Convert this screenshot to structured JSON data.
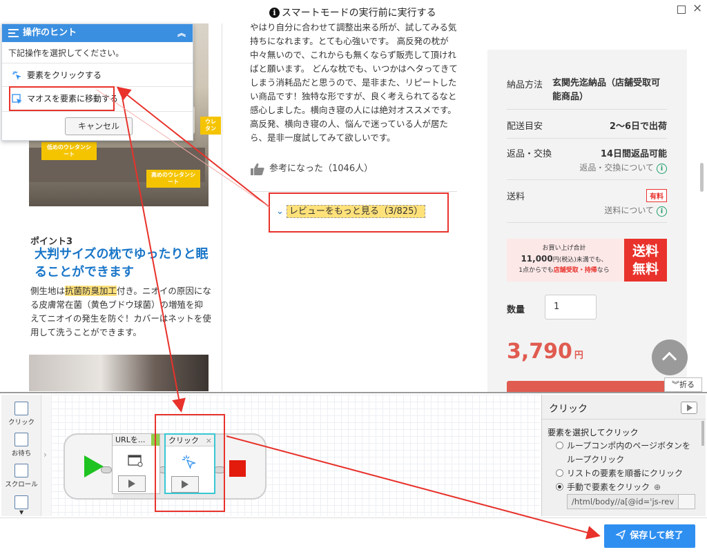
{
  "topbar": {
    "title": "スマートモードの実行前に実行する",
    "info_icon": "i"
  },
  "left_column": {
    "product_tags": [
      "低めのウレタンシート",
      "高めのウレタンシート",
      "ウレタン"
    ],
    "point_label": "ポイント3",
    "point_title": "大判サイズの枕でゆったりと眠ることができます",
    "point_body_pre": "側生地は",
    "point_body_highlight": "抗菌防臭加工",
    "point_body_post": "付き。ニオイの原因になる皮膚常在菌（黄色ブドウ球菌）の増殖を抑えてニオイの発生を防ぐ！カバーはネットを使用して洗うことができます。"
  },
  "review": {
    "text": "やはり自分に合わせて調整出来る所が、試してみる気持ちになれます。とても心強いです。 高反発の枕が中々無いので、これからも無くならず販売して頂ければと願います。 どんな枕でも、いつかはヘタってきてしまう消耗品だと思うので、是非また、リピートしたい商品です！独特な形ですが、良く考えられてるなと感心しました。横向き寝の人には絶対オススメです。高反発、横向き寝の人、悩んで迷っている人が居たら、是非一度試してみて欲しいです。",
    "helpful": "参考になった（1046人）",
    "more_reviews": "レビューをもっと見る（3/825）"
  },
  "info_panel": {
    "delivery_method_label": "納品方法",
    "delivery_method_value": "玄関先迄納品（店舗受取可能商品）",
    "delivery_estimate_label": "配送目安",
    "delivery_estimate_value": "2〜6日で出荷",
    "returns_label": "返品・交換",
    "returns_value": "14日間返品可能",
    "returns_link": "返品・交換について",
    "shipping_label": "送料",
    "shipping_badge": "有料",
    "shipping_link": "送料について",
    "banner_line1": "お買い上げ合計",
    "banner_amount": "11,000",
    "banner_line2_suffix": "円(税込)未満でも、",
    "banner_line3_pre": "1点からでも",
    "banner_line3_red": "店舗受取・持帰",
    "banner_line3_post": "なら",
    "banner_free_line1": "送料",
    "banner_free_line2": "無料",
    "quantity_label": "数量",
    "quantity_value": "1",
    "price": "3,790",
    "price_unit": "円"
  },
  "tooltip": {
    "header": "操作のヒント",
    "description": "下記操作を選択してください。",
    "option_click": "要素をクリックする",
    "option_hover": "マオスを要素に移動する",
    "cancel": "キャンセル"
  },
  "designer": {
    "fold": "折る",
    "toolbox": [
      "クリック",
      "お待ち",
      "スクロール"
    ],
    "node_url": "URLを...",
    "node_click": "クリック"
  },
  "properties": {
    "title": "クリック",
    "section": "要素を選択してクリック",
    "radio1_line1": "ループコンポ内のページボタンを",
    "radio1_line2": "ループクリック",
    "radio2": "リストの要素を順番にクリック",
    "radio3": "手動で要素をクリック",
    "xpath": "/html/body//a[@id='js-rev"
  },
  "footer": {
    "save": "保存して終了"
  },
  "colors": {
    "accent_blue": "#3b8fe0",
    "annotation_red": "#e8322b",
    "price_red": "#e05b50",
    "highlight_yellow": "#ffe17a",
    "play_green": "#1ec321"
  }
}
